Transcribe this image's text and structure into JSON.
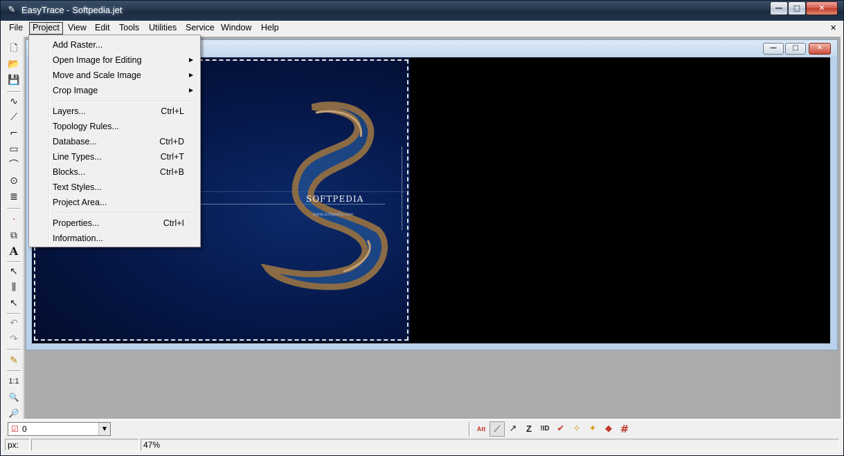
{
  "window": {
    "title": "EasyTrace - Softpedia.jet",
    "min_glyph": "—",
    "max_glyph": "□",
    "close_glyph": "✕"
  },
  "menubar": {
    "items": [
      "File",
      "Project",
      "View",
      "Edit",
      "Tools",
      "Utilities",
      "Service",
      "Window",
      "Help"
    ],
    "active": "Project",
    "mdi_close": "✕"
  },
  "project_menu": {
    "items": [
      {
        "label": "Add Raster...",
        "shortcut": "",
        "submenu": false
      },
      {
        "label": "Open Image for Editing",
        "shortcut": "",
        "submenu": true
      },
      {
        "label": "Move and Scale Image",
        "shortcut": "",
        "submenu": true
      },
      {
        "label": "Crop Image",
        "shortcut": "",
        "submenu": true
      },
      {
        "label": "Layers...",
        "shortcut": "Ctrl+L",
        "submenu": false
      },
      {
        "label": "Topology Rules...",
        "shortcut": "",
        "submenu": false
      },
      {
        "label": "Database...",
        "shortcut": "Ctrl+D",
        "submenu": false
      },
      {
        "label": "Line Types...",
        "shortcut": "Ctrl+T",
        "submenu": false
      },
      {
        "label": "Blocks...",
        "shortcut": "Ctrl+B",
        "submenu": false
      },
      {
        "label": "Text Styles...",
        "shortcut": "",
        "submenu": false
      },
      {
        "label": "Project Area...",
        "shortcut": "",
        "submenu": false
      },
      {
        "label": "Properties...",
        "shortcut": "Ctrl+I",
        "submenu": false
      },
      {
        "label": "Information...",
        "shortcut": "",
        "submenu": false
      }
    ],
    "arrow_glyph": "▶"
  },
  "document": {
    "raster_brand": "SOFTPEDIA",
    "raster_url": "www.softpedia.com"
  },
  "left_toolbar": {
    "tools": [
      {
        "name": "new-project-icon",
        "glyph": "🗋"
      },
      {
        "name": "open-folder-icon",
        "glyph": "📂"
      },
      {
        "name": "save-icon",
        "glyph": "💾"
      },
      {
        "name": "curve-draw-icon",
        "glyph": "∿"
      },
      {
        "name": "polyline-draw-icon",
        "glyph": "⟋"
      },
      {
        "name": "step-line-icon",
        "glyph": "⌐"
      },
      {
        "name": "rectangle-icon",
        "glyph": "▭"
      },
      {
        "name": "arc-icon",
        "glyph": "⌒"
      },
      {
        "name": "circle-icon",
        "glyph": "⊙"
      },
      {
        "name": "hatch-icon",
        "glyph": "≣"
      },
      {
        "name": "point-icon",
        "glyph": "·"
      },
      {
        "name": "shape-tool-icon",
        "glyph": "⧉"
      },
      {
        "name": "text-tool-icon",
        "glyph": "A"
      },
      {
        "name": "select-arrow-icon",
        "glyph": "↖"
      },
      {
        "name": "multi-select-icon",
        "glyph": "⫼"
      },
      {
        "name": "node-select-icon",
        "glyph": "↖"
      },
      {
        "name": "undo-icon",
        "glyph": "↶"
      },
      {
        "name": "redo-icon",
        "glyph": "↷"
      },
      {
        "name": "pencil-icon",
        "glyph": "✎"
      },
      {
        "name": "zoom-1to1-icon",
        "glyph": "1:1"
      },
      {
        "name": "zoom-icon",
        "glyph": "🔍"
      },
      {
        "name": "zoom-area-icon",
        "glyph": "🔎"
      }
    ]
  },
  "layer_selector": {
    "value": "0",
    "check": "☑",
    "arrow": "▼"
  },
  "attr_toolbar": {
    "buttons": [
      {
        "name": "attributes-icon",
        "glyph": "Att",
        "color": "#c0392b"
      },
      {
        "name": "trace-line-icon",
        "glyph": "⟋",
        "color": "#333333"
      },
      {
        "name": "direction-arrow-icon",
        "glyph": "↗",
        "color": "#333333"
      },
      {
        "name": "z-value-icon",
        "glyph": "Z",
        "color": "#333333"
      },
      {
        "name": "object-id-icon",
        "glyph": "!ID",
        "color": "#333333"
      },
      {
        "name": "check-topology-icon",
        "glyph": "✔",
        "color": "#c0392b"
      },
      {
        "name": "magic-wand-icon",
        "glyph": "✧",
        "color": "#d4a017"
      },
      {
        "name": "auto-trace-icon",
        "glyph": "✦",
        "color": "#d4a017"
      },
      {
        "name": "fill-polygon-icon",
        "glyph": "◆",
        "color": "#c0392b"
      },
      {
        "name": "grid-icon",
        "glyph": "#",
        "color": "#c0392b"
      }
    ],
    "pressed_index": 1
  },
  "status": {
    "units": "px:",
    "coords": "",
    "zoom": "47%"
  }
}
